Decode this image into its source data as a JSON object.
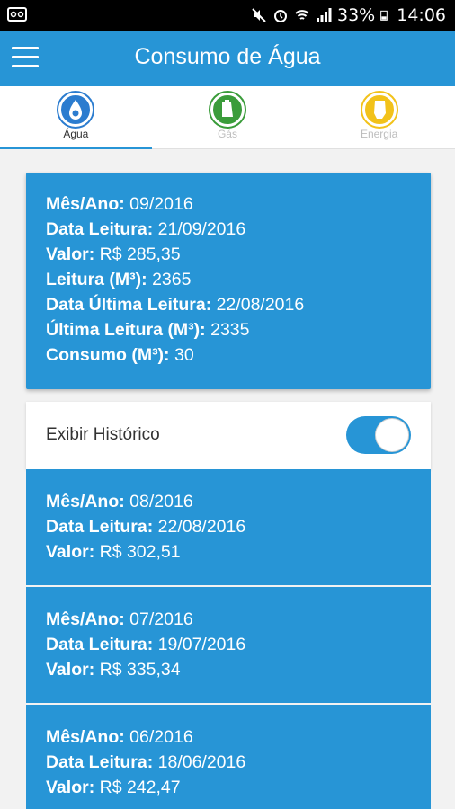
{
  "status": {
    "battery": "33%",
    "time": "14:06"
  },
  "appbar": {
    "title": "Consumo de Água"
  },
  "tabs": [
    {
      "label": "Água",
      "icon": "water-drop-icon",
      "color": "#2b7ccf"
    },
    {
      "label": "Gás",
      "icon": "gas-icon",
      "color": "#3a9c3a"
    },
    {
      "label": "Energia",
      "icon": "energy-icon",
      "color": "#f2c21a"
    }
  ],
  "current": {
    "mes_ano_label": "Mês/Ano:",
    "mes_ano": "09/2016",
    "data_leitura_label": "Data Leitura:",
    "data_leitura": "21/09/2016",
    "valor_label": "Valor:",
    "valor": "R$ 285,35",
    "leitura_label": "Leitura (M³):",
    "leitura": "2365",
    "data_ultima_label": "Data Última Leitura:",
    "data_ultima": "22/08/2016",
    "ultima_leitura_label": "Última Leitura (M³):",
    "ultima_leitura": "2335",
    "consumo_label": "Consumo (M³):",
    "consumo": "30"
  },
  "historico": {
    "label": "Exibir Histórico",
    "enabled": true,
    "items": [
      {
        "mes_ano": "08/2016",
        "data_leitura": "22/08/2016",
        "valor": "R$ 302,51"
      },
      {
        "mes_ano": "07/2016",
        "data_leitura": "19/07/2016",
        "valor": "R$ 335,34"
      },
      {
        "mes_ano": "06/2016",
        "data_leitura": "18/06/2016",
        "valor": "R$ 242,47"
      }
    ],
    "mes_ano_label": "Mês/Ano:",
    "data_leitura_label": "Data Leitura:",
    "valor_label": "Valor:"
  },
  "colors": {
    "primary": "#2795d6",
    "statusbar": "#000000",
    "background": "#f2f2f2"
  }
}
